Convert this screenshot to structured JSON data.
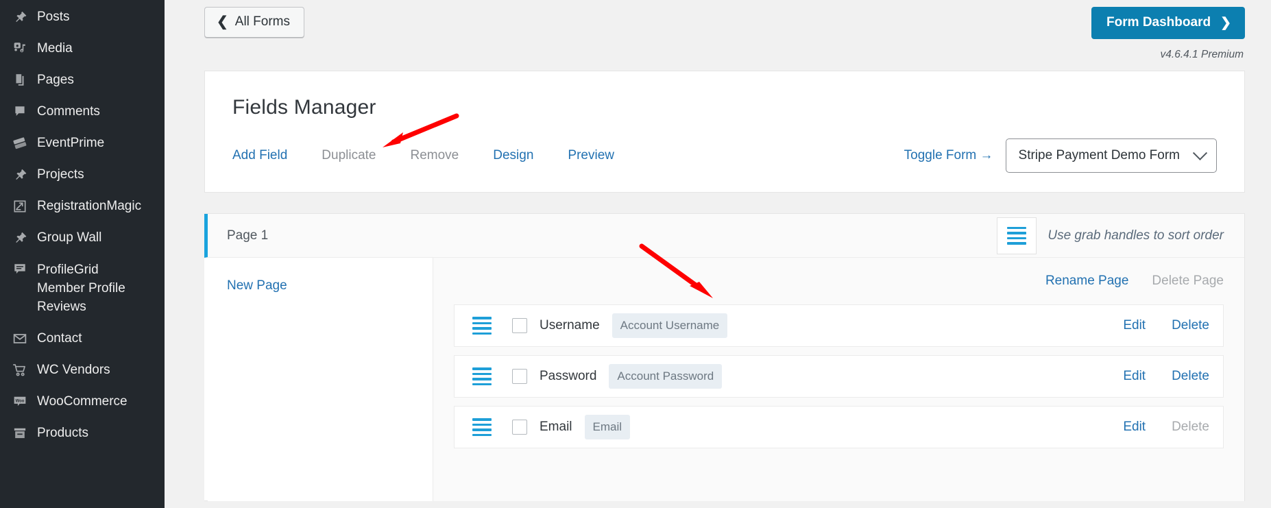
{
  "sidebar": {
    "items": [
      {
        "label": "Posts",
        "icon": "pin-icon"
      },
      {
        "label": "Media",
        "icon": "media-icon"
      },
      {
        "label": "Pages",
        "icon": "pages-icon"
      },
      {
        "label": "Comments",
        "icon": "comment-icon"
      },
      {
        "label": "EventPrime",
        "icon": "ticket-icon"
      },
      {
        "label": "Projects",
        "icon": "pin-icon"
      },
      {
        "label": "RegistrationMagic",
        "icon": "form-edit-icon"
      },
      {
        "label": "Group Wall",
        "icon": "pin-icon"
      },
      {
        "label": "ProfileGrid Member Profile Reviews",
        "icon": "comment-lines-icon"
      },
      {
        "label": "Contact",
        "icon": "envelope-icon"
      },
      {
        "label": "WC Vendors",
        "icon": "cart-icon"
      },
      {
        "label": "WooCommerce",
        "icon": "woo-icon"
      },
      {
        "label": "Products",
        "icon": "products-icon"
      }
    ]
  },
  "topbar": {
    "all_forms_label": "All Forms",
    "all_forms_icon": "chevron-left-icon",
    "dashboard_label": "Form Dashboard",
    "dashboard_icon": "chevron-right-icon",
    "version": "v4.6.4.1 Premium",
    "accent_blue": "#0c7fb0"
  },
  "panel": {
    "title": "Fields Manager",
    "actions": [
      {
        "label": "Add Field",
        "disabled": false
      },
      {
        "label": "Duplicate",
        "disabled": true
      },
      {
        "label": "Remove",
        "disabled": true
      },
      {
        "label": "Design",
        "disabled": false
      },
      {
        "label": "Preview",
        "disabled": false
      }
    ],
    "toggle_form_label": "Toggle Form →",
    "form_select": {
      "value": "Stripe Payment Demo Form",
      "caret_icon": "chevron-down-icon"
    }
  },
  "page_block": {
    "tab_label": "Page 1",
    "grab_icon": "grab-handle-icon",
    "grab_hint": "Use grab handles to sort order",
    "new_page_label": "New Page",
    "rename_page_label": "Rename Page",
    "delete_page_label": "Delete Page",
    "delete_page_disabled": true,
    "accent_bar_color": "#19a3dd",
    "fields": [
      {
        "handle_icon": "grab-handle-icon",
        "checked": false,
        "label": "Username",
        "badge": "Account Username",
        "edit_label": "Edit",
        "delete_label": "Delete",
        "delete_disabled": false
      },
      {
        "handle_icon": "grab-handle-icon",
        "checked": false,
        "label": "Password",
        "badge": "Account Password",
        "edit_label": "Edit",
        "delete_label": "Delete",
        "delete_disabled": false
      },
      {
        "handle_icon": "grab-handle-icon",
        "checked": false,
        "label": "Email",
        "badge": "Email",
        "edit_label": "Edit",
        "delete_label": "Delete",
        "delete_disabled": true
      }
    ]
  },
  "annotations": {
    "color": "#fe0000",
    "arrow_1_target": "Add Field",
    "arrow_2_target": "Username field row"
  }
}
